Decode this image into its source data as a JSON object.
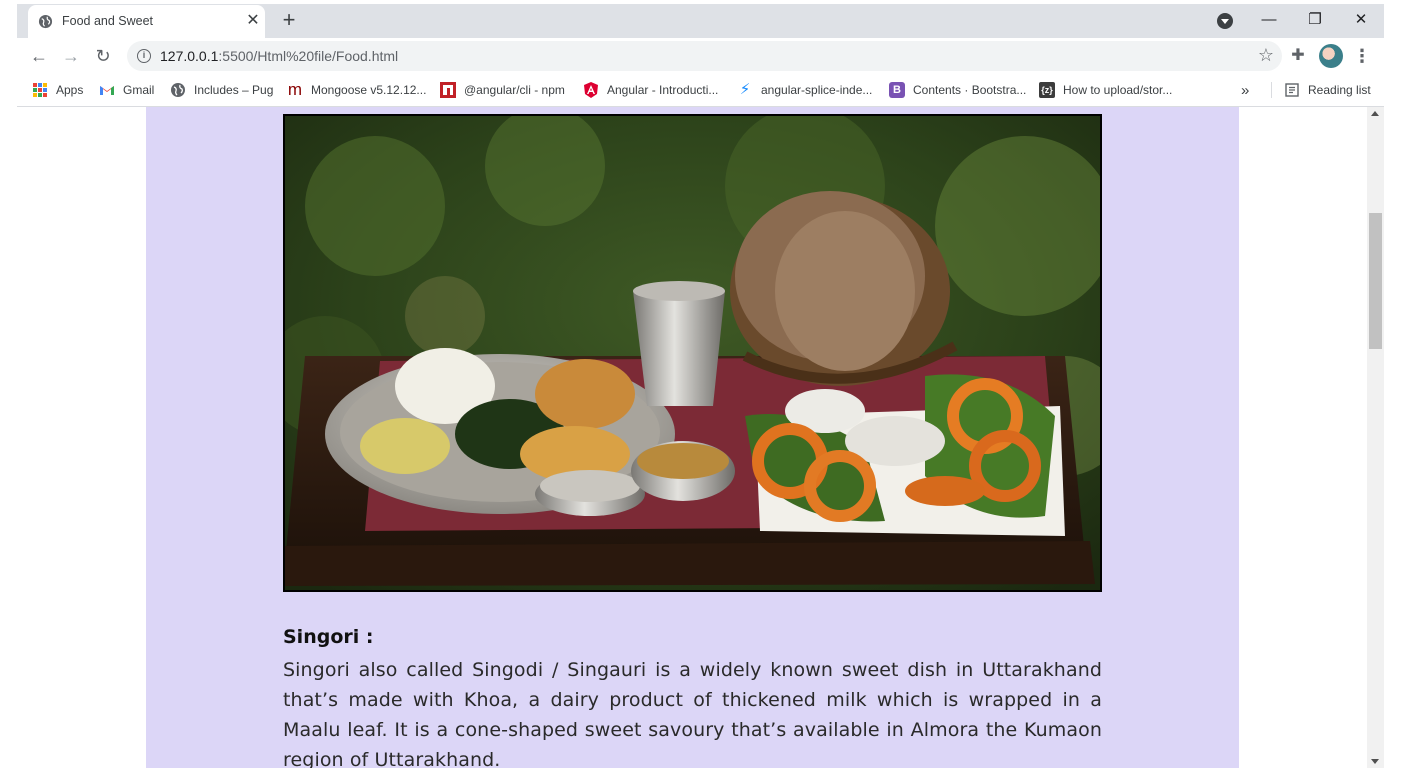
{
  "tab": {
    "title": "Food and Sweet",
    "close_glyph": "✕",
    "new_tab_glyph": "+"
  },
  "window_controls": {
    "minimize": "—",
    "restore": "❐",
    "close": "✕"
  },
  "toolbar": {
    "back_glyph": "←",
    "forward_glyph": "→",
    "reload_glyph": "↻",
    "url_host": "127.0.0.1",
    "url_path": ":5500/Html%20file/Food.html",
    "star_glyph": "☆",
    "extensions_glyph": "✚",
    "menu_glyph": "⋮"
  },
  "bookmarks": {
    "items": [
      {
        "label": "Apps",
        "icon": "apps-grid-icon"
      },
      {
        "label": "Gmail",
        "icon": "gmail-icon"
      },
      {
        "label": "Includes – Pug",
        "icon": "globe-icon"
      },
      {
        "label": "Mongoose v5.12.12...",
        "icon": "mongoose-icon"
      },
      {
        "label": "@angular/cli - npm",
        "icon": "npm-icon"
      },
      {
        "label": "Angular - Introducti...",
        "icon": "angular-icon"
      },
      {
        "label": "angular-splice-inde...",
        "icon": "bolt-icon"
      },
      {
        "label": "Contents · Bootstra...",
        "icon": "bootstrap-icon"
      },
      {
        "label": "How to upload/stor...",
        "icon": "code-icon"
      }
    ],
    "overflow_glyph": "»",
    "reading_list": "Reading list"
  },
  "content": {
    "dish_title": "Singori :",
    "dish_description": "Singori also called Singodi / Singauri is a widely known sweet dish in Uttarakhand that’s made with Khoa, a dairy product of thickened milk which is wrapped in a Maalu leaf. It is a cone-shaped sweet savoury that’s available in Almora the Kumaon region of Uttarakhand."
  },
  "colors": {
    "panel_bg": "#dcd6f7",
    "tabstrip_bg": "#dee1e6",
    "omnibox_bg": "#f1f3f4"
  }
}
